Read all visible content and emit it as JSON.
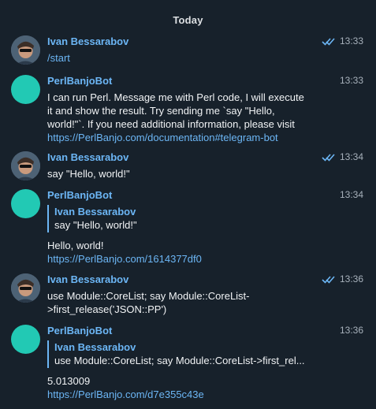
{
  "date_separator": "Today",
  "colors": {
    "background": "#17212b",
    "accent": "#6cb6f5",
    "bot_avatar": "#22c9b4"
  },
  "messages": [
    {
      "sender": "Ivan Bessarabov",
      "time": "13:33",
      "read_status": "double-check-icon",
      "lines": [],
      "link_lines": [
        "/start"
      ]
    },
    {
      "sender": "PerlBanjoBot",
      "time": "13:33",
      "lines": [
        "I can run Perl. Message me with Perl code, I will execute",
        "it and show the result. Try sending me `say \"Hello,",
        "world!\"`. If you need additional information, please visit"
      ],
      "link": "https://PerlBanjo.com/documentation#telegram-bot"
    },
    {
      "sender": "Ivan Bessarabov",
      "time": "13:34",
      "read_status": "double-check-icon",
      "lines": [
        "say \"Hello, world!\""
      ]
    },
    {
      "sender": "PerlBanjoBot",
      "time": "13:34",
      "quote": {
        "name": "Ivan Bessarabov",
        "text": "say \"Hello, world!\""
      },
      "lines": [
        "Hello, world!"
      ],
      "link": "https://PerlBanjo.com/1614377df0"
    },
    {
      "sender": "Ivan Bessarabov",
      "time": "13:36",
      "read_status": "double-check-icon",
      "lines": [
        "use Module::CoreList; say Module::CoreList-",
        ">first_release('JSON::PP')"
      ]
    },
    {
      "sender": "PerlBanjoBot",
      "time": "13:36",
      "quote": {
        "name": "Ivan Bessarabov",
        "text": "use Module::CoreList; say Module::CoreList->first_rel..."
      },
      "lines": [
        "5.013009"
      ],
      "link": "https://PerlBanjo.com/d7e355c43e"
    }
  ]
}
